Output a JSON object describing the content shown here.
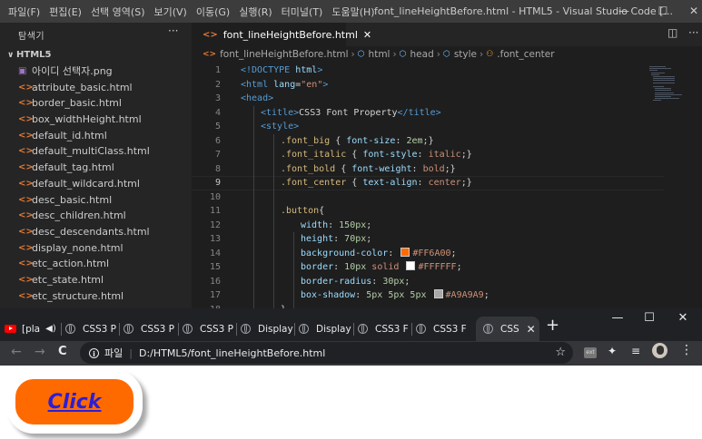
{
  "vscode": {
    "menu": [
      "파일(F)",
      "편집(E)",
      "선택 영역(S)",
      "보기(V)",
      "이동(G)",
      "실행(R)",
      "터미널(T)",
      "도움말(H)"
    ],
    "window_title": "font_lineHeightBefore.html - HTML5 - Visual Studio Code [...",
    "window_controls": {
      "minimize": "—",
      "maximize": "☐",
      "close": "✕"
    },
    "sidebar": {
      "title": "탐색기",
      "more": "···",
      "folder": "HTML5",
      "files": [
        {
          "name": "아이디 선택자.png",
          "type": "png"
        },
        {
          "name": "attribute_basic.html",
          "type": "html"
        },
        {
          "name": "border_basic.html",
          "type": "html"
        },
        {
          "name": "box_widthHeight.html",
          "type": "html"
        },
        {
          "name": "default_id.html",
          "type": "html"
        },
        {
          "name": "default_multiClass.html",
          "type": "html"
        },
        {
          "name": "default_tag.html",
          "type": "html"
        },
        {
          "name": "default_wildcard.html",
          "type": "html"
        },
        {
          "name": "desc_basic.html",
          "type": "html"
        },
        {
          "name": "desc_children.html",
          "type": "html"
        },
        {
          "name": "desc_descendants.html",
          "type": "html"
        },
        {
          "name": "display_none.html",
          "type": "html"
        },
        {
          "name": "etc_action.html",
          "type": "html"
        },
        {
          "name": "etc_state.html",
          "type": "html"
        },
        {
          "name": "etc_structure.html",
          "type": "html"
        }
      ]
    },
    "tab": {
      "label": "font_lineHeightBefore.html",
      "icon": "<>",
      "close": "✕"
    },
    "tab_actions": {
      "split": "◫",
      "more": "···"
    },
    "breadcrumb": [
      "font_lineHeightBefore.html",
      "html",
      "head",
      "style",
      ".font_center"
    ],
    "current_line": 9,
    "code": [
      {
        "n": "1",
        "indent": 0,
        "toks": [
          [
            "tag",
            "<!DOCTYPE"
          ],
          [
            "txt",
            " "
          ],
          [
            "attr",
            "html"
          ],
          [
            "tag",
            ">"
          ]
        ]
      },
      {
        "n": "2",
        "indent": 0,
        "toks": [
          [
            "tag",
            "<html"
          ],
          [
            "txt",
            " "
          ],
          [
            "attr",
            "lang"
          ],
          [
            "txt",
            "="
          ],
          [
            "str",
            "\"en\""
          ],
          [
            "tag",
            ">"
          ]
        ]
      },
      {
        "n": "3",
        "indent": 0,
        "toks": [
          [
            "tag",
            "<head>"
          ]
        ]
      },
      {
        "n": "4",
        "indent": 1,
        "toks": [
          [
            "tag",
            "<title>"
          ],
          [
            "txt",
            "CSS3 Font Property"
          ],
          [
            "tag",
            "</title>"
          ]
        ]
      },
      {
        "n": "5",
        "indent": 1,
        "toks": [
          [
            "tag",
            "<style>"
          ]
        ]
      },
      {
        "n": "6",
        "indent": 2,
        "toks": [
          [
            "sel",
            ".font_big"
          ],
          [
            "txt",
            " { "
          ],
          [
            "prop",
            "font-size"
          ],
          [
            "txt",
            ": "
          ],
          [
            "num",
            "2em"
          ],
          [
            "txt",
            ";}"
          ]
        ]
      },
      {
        "n": "7",
        "indent": 2,
        "toks": [
          [
            "sel",
            ".font_italic"
          ],
          [
            "txt",
            " { "
          ],
          [
            "prop",
            "font-style"
          ],
          [
            "txt",
            ": "
          ],
          [
            "val",
            "italic"
          ],
          [
            "txt",
            ";}"
          ]
        ]
      },
      {
        "n": "8",
        "indent": 2,
        "toks": [
          [
            "sel",
            ".font_bold"
          ],
          [
            "txt",
            " { "
          ],
          [
            "prop",
            "font-weight"
          ],
          [
            "txt",
            ": "
          ],
          [
            "val",
            "bold"
          ],
          [
            "txt",
            ";}"
          ]
        ]
      },
      {
        "n": "9",
        "indent": 2,
        "toks": [
          [
            "sel",
            ".font_center"
          ],
          [
            "txt",
            " { "
          ],
          [
            "prop",
            "text-align"
          ],
          [
            "txt",
            ": "
          ],
          [
            "val",
            "center"
          ],
          [
            "txt",
            ";}"
          ]
        ]
      },
      {
        "n": "10",
        "indent": 2,
        "toks": []
      },
      {
        "n": "11",
        "indent": 2,
        "toks": [
          [
            "sel",
            ".button"
          ],
          [
            "txt",
            "{"
          ]
        ]
      },
      {
        "n": "12",
        "indent": 3,
        "toks": [
          [
            "prop",
            "width"
          ],
          [
            "txt",
            ": "
          ],
          [
            "num",
            "150px"
          ],
          [
            "txt",
            ";"
          ]
        ]
      },
      {
        "n": "13",
        "indent": 3,
        "toks": [
          [
            "prop",
            "height"
          ],
          [
            "txt",
            ": "
          ],
          [
            "num",
            "70px"
          ],
          [
            "txt",
            ";"
          ]
        ]
      },
      {
        "n": "14",
        "indent": 3,
        "toks": [
          [
            "prop",
            "background-color"
          ],
          [
            "txt",
            ": "
          ],
          [
            "swatch",
            "#FF6A00"
          ],
          [
            "val",
            "#FF6A00"
          ],
          [
            "txt",
            ";"
          ]
        ]
      },
      {
        "n": "15",
        "indent": 3,
        "toks": [
          [
            "prop",
            "border"
          ],
          [
            "txt",
            ": "
          ],
          [
            "num",
            "10px"
          ],
          [
            "txt",
            " "
          ],
          [
            "val",
            "solid"
          ],
          [
            "txt",
            " "
          ],
          [
            "swatch",
            "#FFFFFF"
          ],
          [
            "val",
            "#FFFFFF"
          ],
          [
            "txt",
            ";"
          ]
        ]
      },
      {
        "n": "16",
        "indent": 3,
        "toks": [
          [
            "prop",
            "border-radius"
          ],
          [
            "txt",
            ": "
          ],
          [
            "num",
            "30px"
          ],
          [
            "txt",
            ";"
          ]
        ]
      },
      {
        "n": "17",
        "indent": 3,
        "toks": [
          [
            "prop",
            "box-shadow"
          ],
          [
            "txt",
            ": "
          ],
          [
            "num",
            "5px 5px 5px"
          ],
          [
            "txt",
            " "
          ],
          [
            "swatch",
            "#A9A9A9"
          ],
          [
            "val",
            "#A9A9A9"
          ],
          [
            "txt",
            ";"
          ]
        ]
      },
      {
        "n": "18",
        "indent": 2,
        "toks": [
          [
            "txt",
            "}"
          ]
        ]
      }
    ]
  },
  "chrome": {
    "tabs": [
      {
        "title": "[pla",
        "icon": "youtube-icon",
        "audio": true
      },
      {
        "title": "CSS3 P",
        "icon": "globe-icon"
      },
      {
        "title": "CSS3 P",
        "icon": "globe-icon"
      },
      {
        "title": "CSS3 P",
        "icon": "globe-icon"
      },
      {
        "title": "Display",
        "icon": "globe-icon"
      },
      {
        "title": "Display",
        "icon": "globe-icon"
      },
      {
        "title": "CSS3 F",
        "icon": "globe-icon"
      },
      {
        "title": "CSS3 F",
        "icon": "globe-icon"
      },
      {
        "title": "CSS",
        "icon": "globe-icon",
        "active": true
      }
    ],
    "tab_close": "✕",
    "new_tab": "+",
    "window_controls": {
      "minimize": "—",
      "maximize": "☐",
      "close": "✕"
    },
    "nav": {
      "back": "←",
      "forward": "→",
      "reload": "C"
    },
    "omnibox": {
      "info": "i",
      "scheme_label": "파일",
      "url": "D:/HTML5/font_lineHeightBefore.html",
      "star": "☆"
    },
    "toolbar_icons": {
      "ext_badge": "ext",
      "puzzle": "✦",
      "media": "≡",
      "menu": "⋮"
    },
    "page": {
      "button_link": "Click",
      "button_bg": "#FF6A00",
      "button_border": "#FFFFFF",
      "shadow": "#A9A9A9"
    }
  }
}
